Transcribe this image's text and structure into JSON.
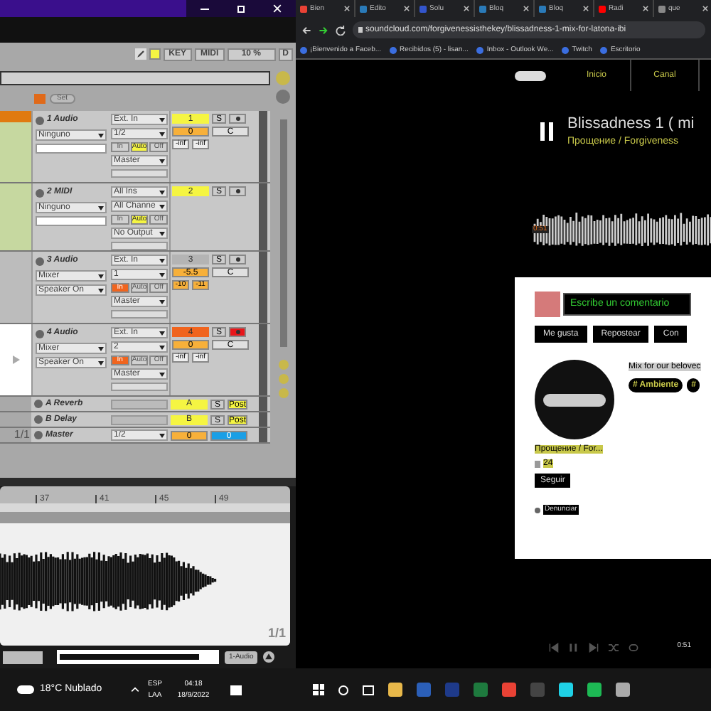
{
  "ableton": {
    "toolbar": {
      "key": "KEY",
      "midi": "MIDI",
      "cpu": "10 %",
      "disk": "D"
    },
    "set_button": "Set",
    "tracks": [
      {
        "kind": "audio",
        "name": "1 Audio",
        "input_type": "Ext. In",
        "input_channel": "1/2",
        "device": "Ninguno",
        "monitor": [
          {
            "label": "In",
            "selected": false
          },
          {
            "label": "Auto",
            "selected": true
          },
          {
            "label": "Off",
            "selected": false
          }
        ],
        "output": "Master",
        "number": "1",
        "color": "#f5f542",
        "solo": "S",
        "armed": false,
        "volume": "0",
        "pan": "C",
        "sends": [
          "-inf",
          "-inf"
        ]
      },
      {
        "kind": "midi",
        "name": "2 MIDI",
        "input_type": "All Ins",
        "input_channel": "All Channe",
        "device": "Ninguno",
        "monitor": [
          {
            "label": "In",
            "selected": false
          },
          {
            "label": "Auto",
            "selected": true
          },
          {
            "label": "Off",
            "selected": false
          }
        ],
        "output": "No Output",
        "number": "2",
        "color": "#f5f542",
        "solo": "S",
        "armed": false
      },
      {
        "kind": "audio",
        "name": "3 Audio",
        "input_type": "Ext. In",
        "input_channel": "1",
        "device": "Mixer",
        "device_2": "Speaker On",
        "monitor": [
          {
            "label": "In",
            "selected": true
          },
          {
            "label": "Auto",
            "selected": false
          },
          {
            "label": "Off",
            "selected": false
          }
        ],
        "output": "Master",
        "number": "3",
        "color": "#b4b4b4",
        "solo": "S",
        "armed": false,
        "volume": "-5.5",
        "pan": "C",
        "sends": [
          "-10",
          "-11"
        ]
      },
      {
        "kind": "audio",
        "name": "4 Audio",
        "input_type": "Ext. In",
        "input_channel": "2",
        "device": "Mixer",
        "device_2": "Speaker On",
        "monitor": [
          {
            "label": "In",
            "selected": true
          },
          {
            "label": "Auto",
            "selected": false
          },
          {
            "label": "Off",
            "selected": false
          }
        ],
        "output": "Master",
        "number": "4",
        "color": "#f0641e",
        "solo": "S",
        "armed": true,
        "volume": "0",
        "pan": "C",
        "sends": [
          "-inf",
          "-inf"
        ]
      },
      {
        "kind": "return",
        "name": "A Reverb",
        "number": "A",
        "color": "#f5f542",
        "solo": "S",
        "post": "Post"
      },
      {
        "kind": "return",
        "name": "B Delay",
        "number": "B",
        "color": "#f5f542",
        "solo": "S",
        "post": "Post"
      },
      {
        "kind": "master",
        "name": "Master",
        "output": "1/2",
        "volume": "0",
        "cue": "0",
        "scene_count": "1/1"
      }
    ],
    "clip": {
      "ruler": [
        "37",
        "41",
        "45",
        "49"
      ],
      "page": "1/1"
    },
    "bottom": {
      "track": "1-Audio"
    }
  },
  "taskbar": {
    "weather": "18°C Nublado",
    "lang_1": "ESP",
    "lang_2": "LAA",
    "time": "04:18",
    "date": "18/9/2022"
  },
  "browser": {
    "tabs": [
      "Bien",
      "Edito",
      "Solu",
      "Bloq",
      "Bloq",
      "Radi",
      "que"
    ],
    "url": "soundcloud.com/forgivenessisthekey/blissadness-1-mix-for-latona-ibi",
    "bookmarks": [
      "¡Bienvenido a Faceb...",
      "Recibidos (5) - lisan...",
      "Inbox - Outlook We...",
      "Twitch",
      "Escritorio"
    ],
    "nav": [
      "Inicio",
      "Canal"
    ],
    "track_title": "Blissadness 1 ( mi",
    "artist": "Прощение / Forgiveness",
    "position": "0:51",
    "comment_placeholder": "Escribe un comentario",
    "actions": [
      "Me gusta",
      "Repostear",
      "Con"
    ],
    "description": "Mix for our belovec",
    "tags": [
      "# Ambiente",
      "#"
    ],
    "profile_name": "Прощение / For...",
    "followers": "24",
    "follow": "Seguir",
    "report": "Denunciar",
    "player_time": "0:51"
  }
}
